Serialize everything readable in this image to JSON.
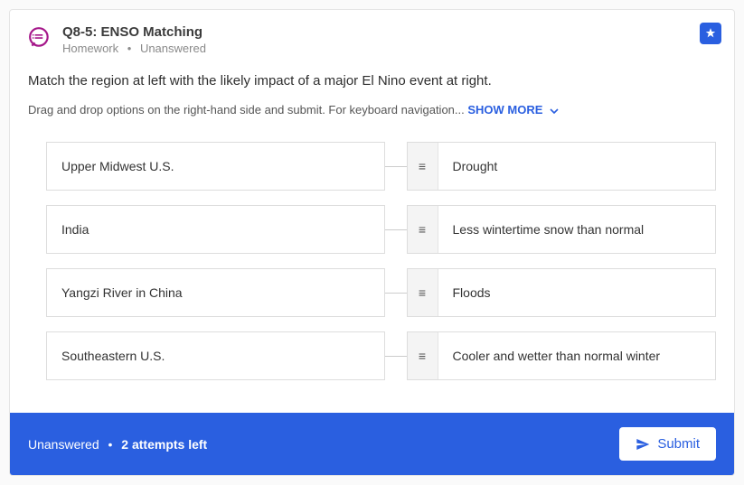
{
  "header": {
    "title": "Q8-5: ENSO Matching",
    "category": "Homework",
    "status": "Unanswered"
  },
  "prompt": "Match the region at left with the likely impact of a major El Nino event at right.",
  "hint_prefix": "Drag and drop options on the right-hand side and submit. For keyboard navigation... ",
  "show_more_label": "SHOW MORE",
  "pairs": {
    "left": [
      "Upper Midwest U.S.",
      "India",
      "Yangzi River in China",
      "Southeastern U.S."
    ],
    "right": [
      "Drought",
      "Less wintertime snow than normal",
      "Floods",
      "Cooler and wetter than normal winter"
    ]
  },
  "footer": {
    "status": "Unanswered",
    "attempts": "2 attempts left",
    "submit_label": "Submit"
  }
}
